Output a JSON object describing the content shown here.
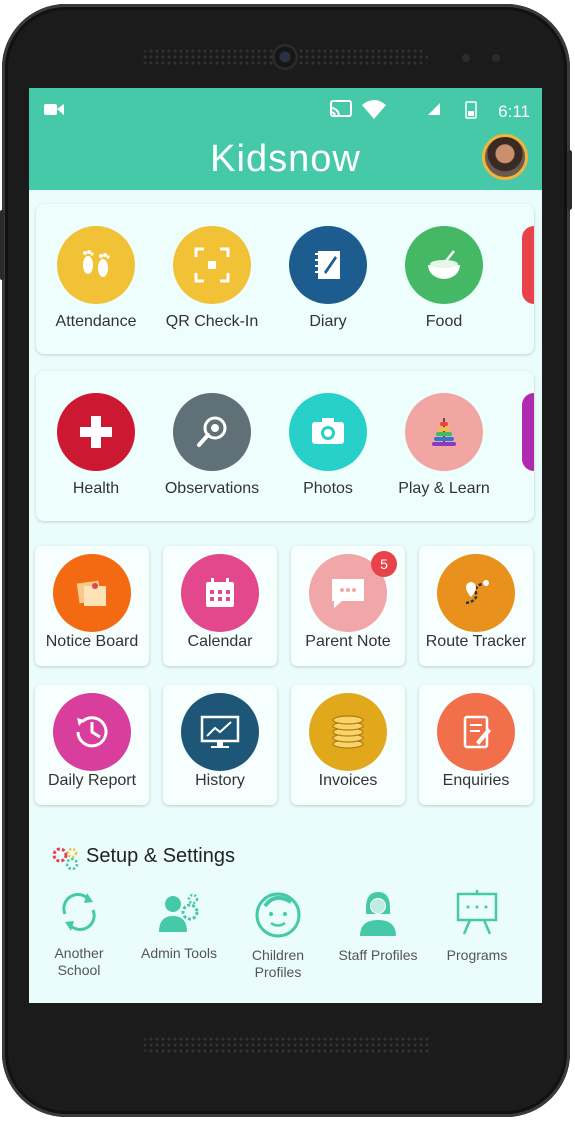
{
  "statusbar": {
    "time": "6:11"
  },
  "appbar": {
    "title": "Kidsnow"
  },
  "colors": {
    "accent": "#45c9a9"
  },
  "row1": [
    {
      "label": "Attendance",
      "icon": "footprints-icon",
      "color": "#f2c236"
    },
    {
      "label": "QR Check-In",
      "icon": "qr-scan-icon",
      "color": "#f2c236"
    },
    {
      "label": "Diary",
      "icon": "diary-icon",
      "color": "#1d5c8e"
    },
    {
      "label": "Food",
      "icon": "food-bowl-icon",
      "color": "#45b866"
    }
  ],
  "row2": [
    {
      "label": "Health",
      "icon": "health-cross-icon",
      "color": "#cc1830"
    },
    {
      "label": "Observations",
      "icon": "magnifier-icon",
      "color": "#5f7177"
    },
    {
      "label": "Photos",
      "icon": "camera-icon",
      "color": "#27d0c8"
    },
    {
      "label": "Play & Learn",
      "icon": "ring-stack-toy-icon",
      "color": "#f2a6a4"
    }
  ],
  "row3": [
    {
      "label": "Notice Board",
      "icon": "notice-board-icon",
      "color": "#f46a12"
    },
    {
      "label": "Calendar",
      "icon": "calendar-icon",
      "color": "#e2488b"
    },
    {
      "label": "Parent Note",
      "icon": "chat-bubble-icon",
      "color": "#f1a7a8",
      "badge": "5"
    },
    {
      "label": "Route Tracker",
      "icon": "route-map-icon",
      "color": "#e8911c"
    }
  ],
  "row4": [
    {
      "label": "Daily Report",
      "icon": "clock-history-icon",
      "color": "#d93e9c"
    },
    {
      "label": "History",
      "icon": "chart-monitor-icon",
      "color": "#1d5677"
    },
    {
      "label": "Invoices",
      "icon": "coins-icon",
      "color": "#e2a81b"
    },
    {
      "label": "Enquiries",
      "icon": "notebook-pen-icon",
      "color": "#f16f4b"
    }
  ],
  "setup": {
    "title": "Setup & Settings",
    "items": [
      {
        "label1": "Another",
        "label2": "School",
        "icon": "sync-icon"
      },
      {
        "label1": "Admin Tools",
        "label2": "",
        "icon": "admin-tools-icon"
      },
      {
        "label1": "Children",
        "label2": "Profiles",
        "icon": "child-face-icon"
      },
      {
        "label1": "Staff Profiles",
        "label2": "",
        "icon": "staff-person-icon"
      },
      {
        "label1": "Programs",
        "label2": "",
        "icon": "board-easel-icon"
      }
    ]
  }
}
